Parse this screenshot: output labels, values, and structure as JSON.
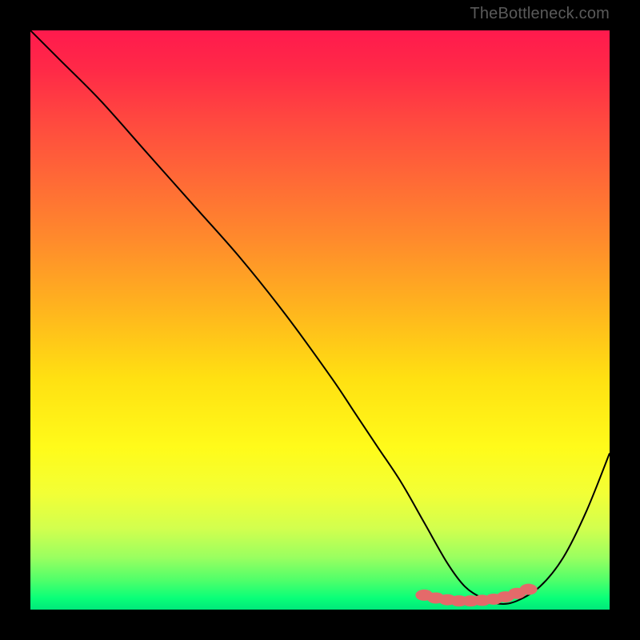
{
  "attribution": "TheBottleneck.com",
  "chart_data": {
    "type": "line",
    "title": "",
    "xlabel": "",
    "ylabel": "",
    "x": [
      0,
      5,
      12,
      20,
      28,
      36,
      44,
      52,
      56,
      60,
      64,
      68,
      72,
      75,
      78,
      81,
      84,
      88,
      92,
      96,
      100
    ],
    "y": [
      100,
      95,
      88,
      79,
      70,
      61,
      51,
      40,
      34,
      28,
      22,
      15,
      8,
      4,
      2,
      1,
      1.5,
      4,
      9,
      17,
      27
    ],
    "xlim": [
      0,
      100
    ],
    "ylim": [
      0,
      100
    ],
    "markers_x": [
      68,
      70,
      72,
      74,
      76,
      78,
      80,
      82,
      84,
      86
    ],
    "markers_y": [
      2.5,
      2,
      1.7,
      1.5,
      1.5,
      1.6,
      1.8,
      2.2,
      2.8,
      3.5
    ],
    "gradient_colormap": "rainbow_r",
    "gradient_axis": "vertical",
    "note": "x and y are in percent of plot area (0–100). y=0 is bottom, y=100 is top."
  }
}
